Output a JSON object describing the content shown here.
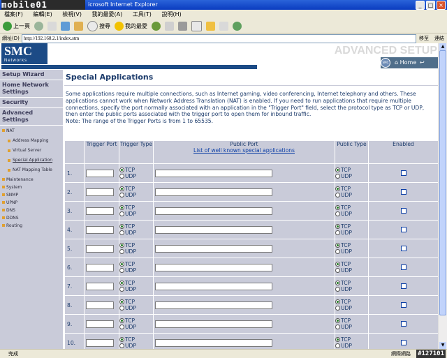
{
  "window": {
    "watermark_logo": "mobile01",
    "title": "icrosoft Internet Explorer",
    "menu": [
      "檔案(F)",
      "編輯(E)",
      "檢視(V)",
      "我的最愛(A)",
      "工具(T)",
      "說明(H)"
    ]
  },
  "toolbar": {
    "back": "上一頁",
    "search": "搜尋",
    "favorites": "我的最愛"
  },
  "address": {
    "label": "網址(D)",
    "url": "http://192.168.2.1/index.stm",
    "go": "移至",
    "links": "連結"
  },
  "header": {
    "logo": "SMC",
    "logo_sub": "Networks",
    "advanced_setup": "ADVANCED SETUP",
    "home": "Home",
    "logout": "Logout"
  },
  "sidebar": {
    "setup_wizard": "Setup Wizard",
    "home_network_settings": "Home Network Settings",
    "security": "Security",
    "advanced_settings": "Advanced Settings",
    "nat": "NAT",
    "nat_items": [
      "Address Mapping",
      "Virtual Server",
      "Special Application",
      "NAT Mapping Table"
    ],
    "other_items": [
      "Maintenance",
      "System",
      "SNMP",
      "UPNP",
      "DNS",
      "DDNS",
      "Routing"
    ]
  },
  "main": {
    "heading": "Special Applications",
    "description": "Some applications require multiple connections, such as Internet gaming, video conferencing, Internet telephony and others. These applications cannot work when Network Address Translation (NAT) is enabled. If you need to run applications that require multiple connections, specify the port normally associated with an application in the \"Trigger Port\" field, select the protocol type as TCP or UDP, then enter the public ports associated with the trigger port to open them for inbound traffic.",
    "note": "Note: The range of the Trigger Ports is from 1 to 65535.",
    "columns": {
      "trigger_port": "Trigger Port",
      "trigger_type": "Trigger Type",
      "public_port": "Public Port",
      "public_port_link": "List of well known special applications",
      "public_type": "Public Type",
      "enabled": "Enabled"
    },
    "tcp": "TCP",
    "udp": "UDP",
    "rows": [
      "1.",
      "2.",
      "3.",
      "4.",
      "5.",
      "6.",
      "7.",
      "8.",
      "9.",
      "10."
    ]
  },
  "status": {
    "text": "完成",
    "zone": "網際網路",
    "watermark": "#127101"
  }
}
